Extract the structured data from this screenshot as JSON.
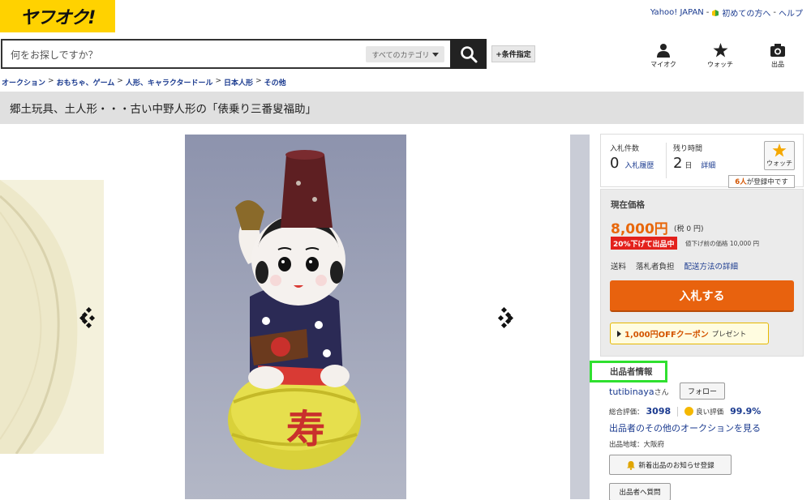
{
  "header": {
    "logo": "ヤフオク!",
    "links": [
      "Yahoo! JAPAN",
      "初めての方へ",
      "ヘルプ"
    ],
    "search_placeholder": "何をお探しですか？",
    "category": "すべてのカテゴリ",
    "conditions": "+条件指定",
    "icons": [
      {
        "name": "user-icon",
        "label": "マイオク"
      },
      {
        "name": "star-icon",
        "label": "ウォッチ"
      },
      {
        "name": "camera-icon",
        "label": "出品"
      }
    ]
  },
  "breadcrumb": [
    "オークション",
    "おもちゃ、ゲーム",
    "人形、キャラクタードール",
    "日本人形",
    "その他"
  ],
  "title": "郷土玩具、土人形・・・古い中野人形の「俵乗り三番叟福助」",
  "bid_info": {
    "bids_label": "入札件数",
    "bids_count": "0",
    "bid_history_link": "入札履歴",
    "remaining_label": "残り時間",
    "remaining_value": "2",
    "remaining_unit": "日",
    "details_link": "詳細",
    "watch_label": "ウォッチ",
    "watchers_count": "6人",
    "watchers_suffix": "が登録中です"
  },
  "price": {
    "label": "現在価格",
    "value": "8,000円",
    "tax": "(税 0 円)",
    "discount_badge": "20%下げて出品中",
    "discount_note": "値下げ前の価格 10,000 円",
    "shipping_label": "送料",
    "shipping_value": "落札者負担",
    "shipping_link": "配送方法の詳細",
    "bid_button": "入札する",
    "coupon_main": "1,000円OFFクーポン",
    "coupon_suffix": "プレゼント"
  },
  "seller": {
    "heading": "出品者情報",
    "name": "tutibinaya",
    "honorific": "さん",
    "follow": "フォロー",
    "total_label": "総合評価：",
    "total_value": "3098",
    "good_label": "良い評価",
    "good_value": "99.9%",
    "other_auctions": "出品者のその他のオークションを見る",
    "region": "出品地域：大阪府",
    "notify": "新着出品のお知らせ登録",
    "ask": "出品者へ質問"
  },
  "colors": {
    "logo_bg": "#ffd200",
    "accent": "#e8620e",
    "link": "#1a3a8f",
    "highlight": "#2fe02f"
  }
}
